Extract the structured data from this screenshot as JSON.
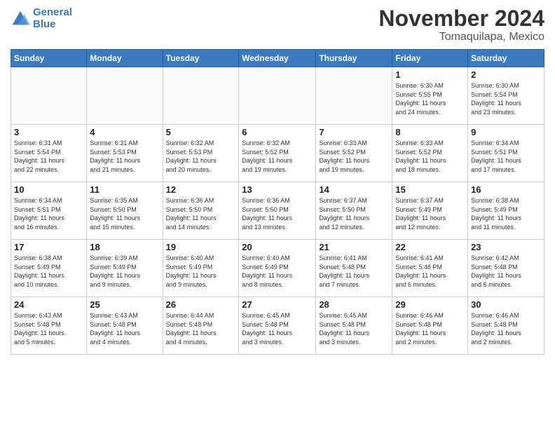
{
  "header": {
    "logo_line1": "General",
    "logo_line2": "Blue",
    "month": "November 2024",
    "location": "Tomaquilapa, Mexico"
  },
  "weekdays": [
    "Sunday",
    "Monday",
    "Tuesday",
    "Wednesday",
    "Thursday",
    "Friday",
    "Saturday"
  ],
  "weeks": [
    [
      {
        "day": "",
        "info": ""
      },
      {
        "day": "",
        "info": ""
      },
      {
        "day": "",
        "info": ""
      },
      {
        "day": "",
        "info": ""
      },
      {
        "day": "",
        "info": ""
      },
      {
        "day": "1",
        "info": "Sunrise: 6:30 AM\nSunset: 5:55 PM\nDaylight: 11 hours\nand 24 minutes."
      },
      {
        "day": "2",
        "info": "Sunrise: 6:30 AM\nSunset: 5:54 PM\nDaylight: 11 hours\nand 23 minutes."
      }
    ],
    [
      {
        "day": "3",
        "info": "Sunrise: 6:31 AM\nSunset: 5:54 PM\nDaylight: 11 hours\nand 22 minutes."
      },
      {
        "day": "4",
        "info": "Sunrise: 6:31 AM\nSunset: 5:53 PM\nDaylight: 11 hours\nand 21 minutes."
      },
      {
        "day": "5",
        "info": "Sunrise: 6:32 AM\nSunset: 5:53 PM\nDaylight: 11 hours\nand 20 minutes."
      },
      {
        "day": "6",
        "info": "Sunrise: 6:32 AM\nSunset: 5:52 PM\nDaylight: 11 hours\nand 19 minutes."
      },
      {
        "day": "7",
        "info": "Sunrise: 6:33 AM\nSunset: 5:52 PM\nDaylight: 11 hours\nand 19 minutes."
      },
      {
        "day": "8",
        "info": "Sunrise: 6:33 AM\nSunset: 5:52 PM\nDaylight: 11 hours\nand 18 minutes."
      },
      {
        "day": "9",
        "info": "Sunrise: 6:34 AM\nSunset: 5:51 PM\nDaylight: 11 hours\nand 17 minutes."
      }
    ],
    [
      {
        "day": "10",
        "info": "Sunrise: 6:34 AM\nSunset: 5:51 PM\nDaylight: 11 hours\nand 16 minutes."
      },
      {
        "day": "11",
        "info": "Sunrise: 6:35 AM\nSunset: 5:50 PM\nDaylight: 11 hours\nand 15 minutes."
      },
      {
        "day": "12",
        "info": "Sunrise: 6:36 AM\nSunset: 5:50 PM\nDaylight: 11 hours\nand 14 minutes."
      },
      {
        "day": "13",
        "info": "Sunrise: 6:36 AM\nSunset: 5:50 PM\nDaylight: 11 hours\nand 13 minutes."
      },
      {
        "day": "14",
        "info": "Sunrise: 6:37 AM\nSunset: 5:50 PM\nDaylight: 11 hours\nand 12 minutes."
      },
      {
        "day": "15",
        "info": "Sunrise: 6:37 AM\nSunset: 5:49 PM\nDaylight: 11 hours\nand 12 minutes."
      },
      {
        "day": "16",
        "info": "Sunrise: 6:38 AM\nSunset: 5:49 PM\nDaylight: 11 hours\nand 11 minutes."
      }
    ],
    [
      {
        "day": "17",
        "info": "Sunrise: 6:38 AM\nSunset: 5:49 PM\nDaylight: 11 hours\nand 10 minutes."
      },
      {
        "day": "18",
        "info": "Sunrise: 6:39 AM\nSunset: 5:49 PM\nDaylight: 11 hours\nand 9 minutes."
      },
      {
        "day": "19",
        "info": "Sunrise: 6:40 AM\nSunset: 5:49 PM\nDaylight: 11 hours\nand 9 minutes."
      },
      {
        "day": "20",
        "info": "Sunrise: 6:40 AM\nSunset: 5:49 PM\nDaylight: 11 hours\nand 8 minutes."
      },
      {
        "day": "21",
        "info": "Sunrise: 6:41 AM\nSunset: 5:48 PM\nDaylight: 11 hours\nand 7 minutes."
      },
      {
        "day": "22",
        "info": "Sunrise: 6:41 AM\nSunset: 5:48 PM\nDaylight: 11 hours\nand 6 minutes."
      },
      {
        "day": "23",
        "info": "Sunrise: 6:42 AM\nSunset: 5:48 PM\nDaylight: 11 hours\nand 6 minutes."
      }
    ],
    [
      {
        "day": "24",
        "info": "Sunrise: 6:43 AM\nSunset: 5:48 PM\nDaylight: 11 hours\nand 5 minutes."
      },
      {
        "day": "25",
        "info": "Sunrise: 6:43 AM\nSunset: 5:48 PM\nDaylight: 11 hours\nand 4 minutes."
      },
      {
        "day": "26",
        "info": "Sunrise: 6:44 AM\nSunset: 5:48 PM\nDaylight: 11 hours\nand 4 minutes."
      },
      {
        "day": "27",
        "info": "Sunrise: 6:45 AM\nSunset: 5:48 PM\nDaylight: 11 hours\nand 3 minutes."
      },
      {
        "day": "28",
        "info": "Sunrise: 6:45 AM\nSunset: 5:48 PM\nDaylight: 11 hours\nand 3 minutes."
      },
      {
        "day": "29",
        "info": "Sunrise: 6:46 AM\nSunset: 5:48 PM\nDaylight: 11 hours\nand 2 minutes."
      },
      {
        "day": "30",
        "info": "Sunrise: 6:46 AM\nSunset: 5:48 PM\nDaylight: 11 hours\nand 2 minutes."
      }
    ]
  ]
}
